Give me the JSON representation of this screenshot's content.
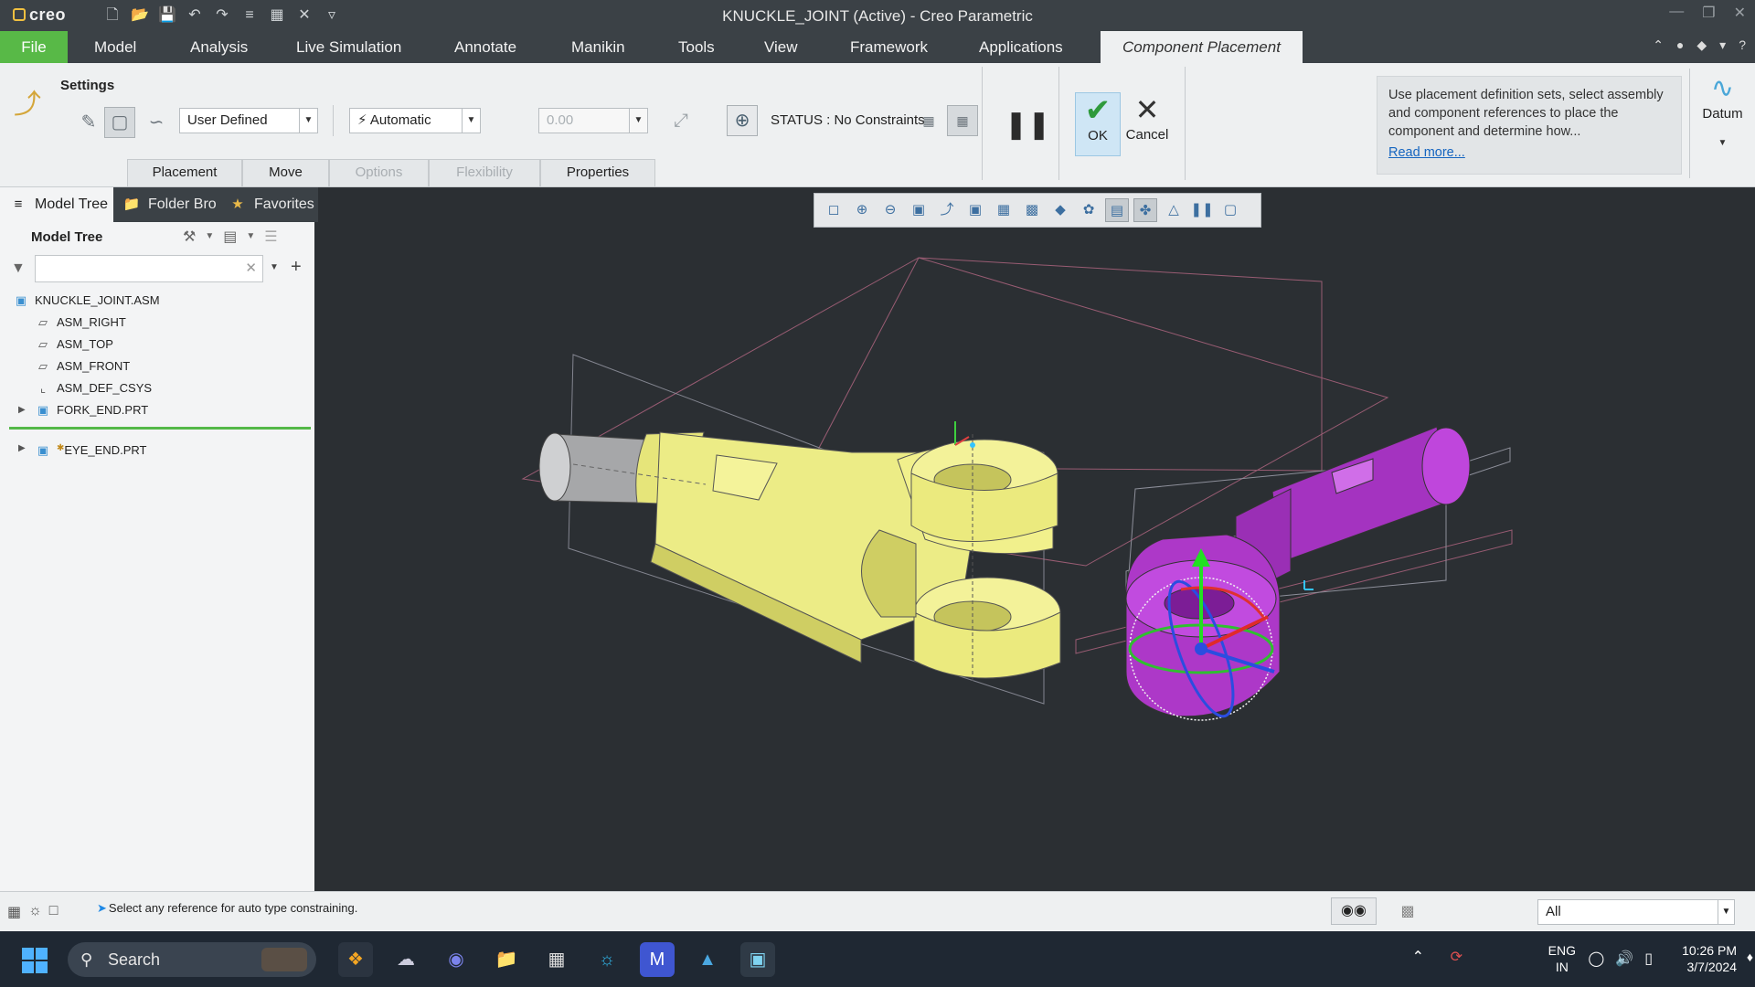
{
  "window": {
    "title": "KNUCKLE_JOINT (Active) - Creo Parametric",
    "logo_text": "creo"
  },
  "tabs": [
    {
      "label": "File"
    },
    {
      "label": "Model"
    },
    {
      "label": "Analysis"
    },
    {
      "label": "Live Simulation"
    },
    {
      "label": "Annotate"
    },
    {
      "label": "Manikin"
    },
    {
      "label": "Tools"
    },
    {
      "label": "View"
    },
    {
      "label": "Framework"
    },
    {
      "label": "Applications"
    },
    {
      "label": "Component Placement"
    }
  ],
  "ribbon": {
    "settings_label": "Settings",
    "constraint_set": "User Defined",
    "constraint_type": "Automatic",
    "offset_value": "0.00",
    "status_text": "STATUS : No Constraints",
    "ok_label": "OK",
    "cancel_label": "Cancel",
    "datum_label": "Datum",
    "hint_text": "Use placement definition sets, select assembly and component references to place the component and determine how...",
    "hint_link": "Read more...",
    "subtabs": [
      "Placement",
      "Move",
      "Options",
      "Flexibility",
      "Properties"
    ]
  },
  "navigator": {
    "tabs": [
      "Model Tree",
      "Folder Bro",
      "Favorites"
    ],
    "header": "Model Tree",
    "filter_value": "",
    "items": [
      {
        "label": "KNUCKLE_JOINT.ASM",
        "icon": "assembly-icon"
      },
      {
        "label": "ASM_RIGHT",
        "icon": "datum-plane-icon"
      },
      {
        "label": "ASM_TOP",
        "icon": "datum-plane-icon"
      },
      {
        "label": "ASM_FRONT",
        "icon": "datum-plane-icon"
      },
      {
        "label": "ASM_DEF_CSYS",
        "icon": "csys-icon"
      },
      {
        "label": "FORK_END.PRT",
        "icon": "part-icon"
      },
      {
        "label": "EYE_END.PRT",
        "icon": "part-icon"
      }
    ]
  },
  "status": {
    "message": "Select any reference for auto type constraining.",
    "selection_filter": "All"
  },
  "taskbar": {
    "search_placeholder": "Search",
    "lang_top": "ENG",
    "lang_bottom": "IN",
    "time": "10:26 PM",
    "date": "3/7/2024"
  },
  "colors": {
    "fork_end": "#f0ef8f",
    "eye_end": "#b43ad2",
    "file_tab": "#58b947",
    "ok_check": "#2f9a3c"
  }
}
